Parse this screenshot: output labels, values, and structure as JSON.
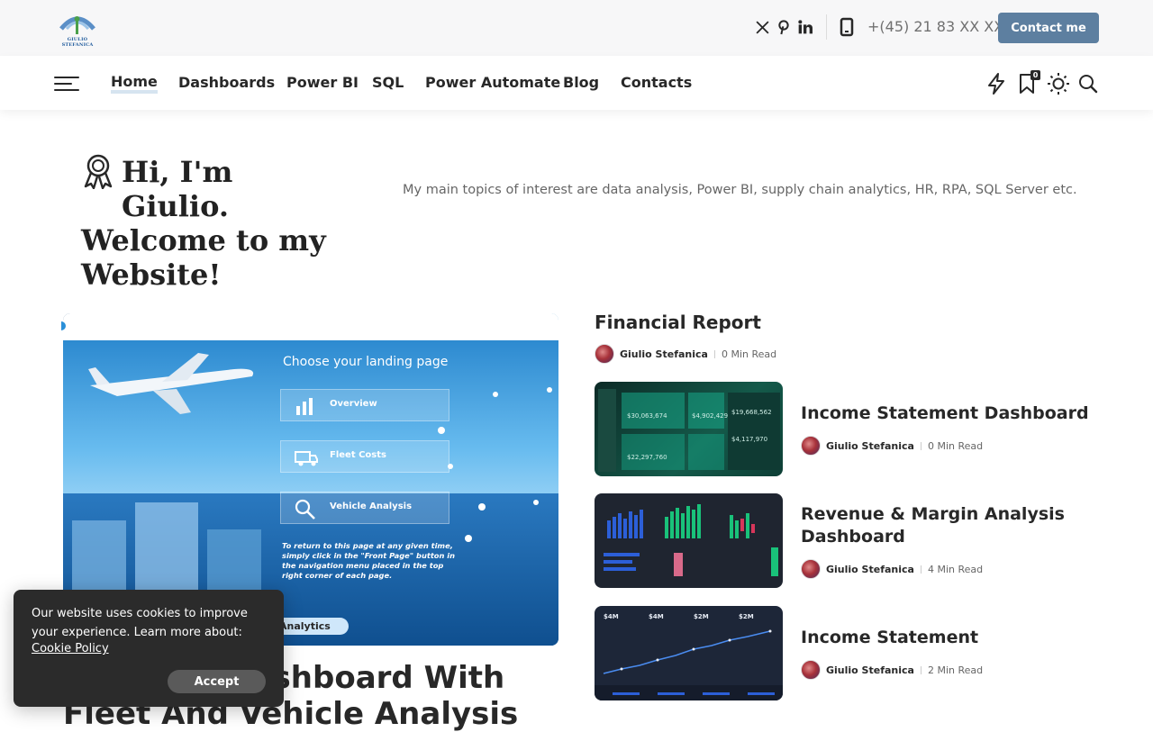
{
  "topbar": {
    "logo_text": "GIULIO STEFANICA",
    "social_icons": [
      "x-icon",
      "pinterest-icon",
      "linkedin-icon"
    ],
    "phone_icon": "phone-icon",
    "phone": "+(45) 21 83 XX XX",
    "contact_label": "Contact me"
  },
  "nav": {
    "items": [
      {
        "label": "Home",
        "active": true
      },
      {
        "label": "Dashboards"
      },
      {
        "label": "Power BI"
      },
      {
        "label": "SQL"
      },
      {
        "label": "Power Automate"
      },
      {
        "label": "Blog"
      },
      {
        "label": "Contacts"
      }
    ],
    "icons": [
      "lightning-icon",
      "bookmark-icon",
      "sun-icon",
      "search-icon"
    ],
    "bookmark_count": "0"
  },
  "hero": {
    "title_line1": "Hi, I'm Giulio.",
    "title_line2": "Welcome to my",
    "title_line3": "Website!",
    "description": "My main topics of interest are data analysis, Power BI, supply chain analytics, HR, RPA, SQL Server etc."
  },
  "featured": {
    "image": {
      "panel_title": "Choose your landing page",
      "cards": [
        "Overview",
        "Fleet Costs",
        "Vehicle Analysis"
      ],
      "note": "To return to this page at any given time, simply click in the \"Front Page\" button in the navigation menu placed in the top right corner of each page."
    },
    "category": "Analytics",
    "title": "Logistics Dashboard With Fleet And Vehicle Analysis"
  },
  "sidebar_feature": {
    "title": "Financial Report",
    "author": "Giulio Stefanica",
    "read": "0 Min Read"
  },
  "posts": [
    {
      "title": "Income Statement Dashboard",
      "author": "Giulio Stefanica",
      "read": "0 Min Read"
    },
    {
      "title": "Revenue & Margin Analysis Dashboard",
      "author": "Giulio Stefanica",
      "read": "4 Min Read"
    },
    {
      "title": "Income Statement",
      "author": "Giulio Stefanica",
      "read": "2 Min Read"
    }
  ],
  "cookie": {
    "text": "Our website uses cookies to improve your experience. Learn more about:",
    "link": "Cookie Policy",
    "accept": "Accept"
  },
  "colors": {
    "accent": "#5d7fa0",
    "text": "#282828",
    "muted": "#666666",
    "cookie_bg": "#2b2b2b"
  }
}
